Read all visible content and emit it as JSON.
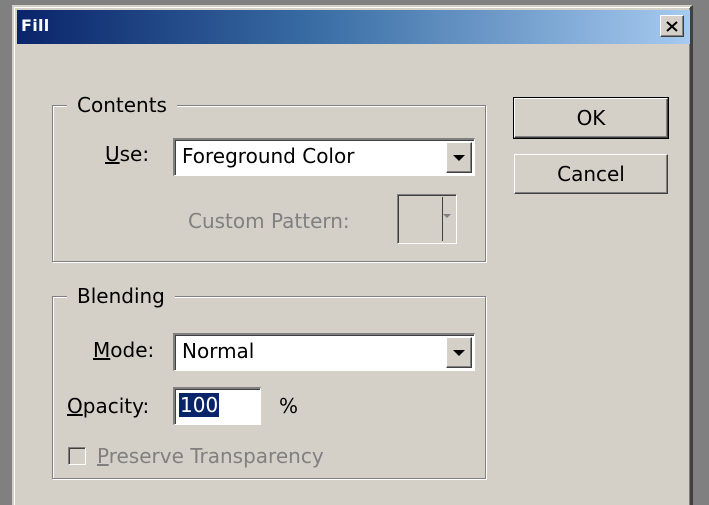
{
  "dialog": {
    "title": "Fill",
    "close_icon": "close-icon"
  },
  "contents": {
    "legend": "Contents",
    "use_label_accel": "U",
    "use_label_rest": "se:",
    "use_value": "Foreground Color",
    "custom_pattern_label": "Custom Pattern:"
  },
  "blending": {
    "legend": "Blending",
    "mode_label_accel": "M",
    "mode_label_rest": "ode:",
    "mode_value": "Normal",
    "opacity_label_accel": "O",
    "opacity_label_rest": "pacity:",
    "opacity_value": "100",
    "opacity_unit": "%",
    "preserve_label_accel": "P",
    "preserve_label_rest": "reserve Transparency",
    "preserve_checked": false
  },
  "buttons": {
    "ok": "OK",
    "cancel": "Cancel"
  },
  "colors": {
    "title_start": "#0a246a",
    "title_end": "#a6caf0",
    "face": "#d4d0c8",
    "disabled_text": "#808080",
    "selection": "#0a246a"
  }
}
